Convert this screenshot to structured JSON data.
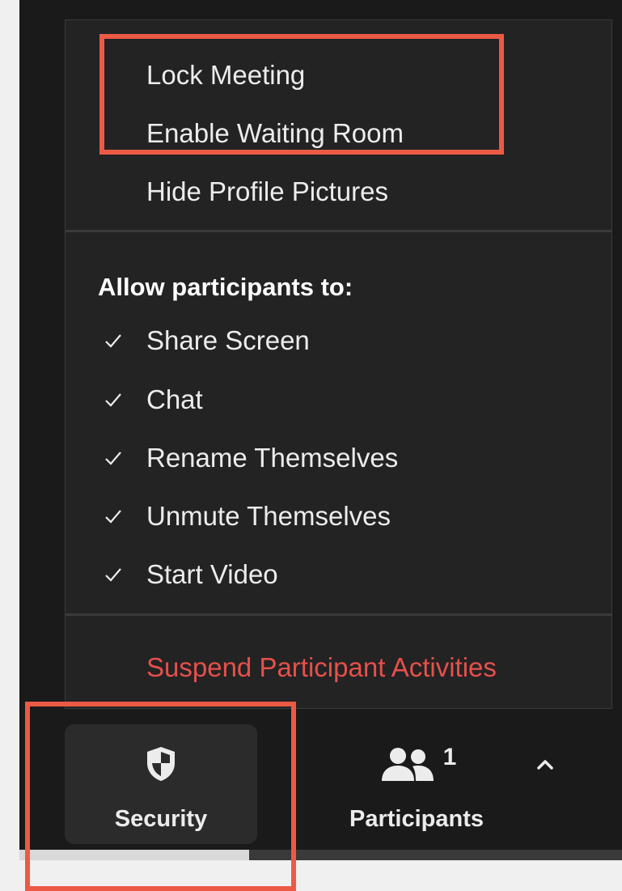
{
  "security_menu": {
    "items": [
      {
        "label": "Lock Meeting"
      },
      {
        "label": "Enable Waiting Room"
      },
      {
        "label": "Hide Profile Pictures"
      }
    ],
    "allow_heading": "Allow participants to:",
    "permissions": [
      {
        "label": "Share Screen",
        "checked": true
      },
      {
        "label": "Chat",
        "checked": true
      },
      {
        "label": "Rename Themselves",
        "checked": true
      },
      {
        "label": "Unmute Themselves",
        "checked": true
      },
      {
        "label": "Start Video",
        "checked": true
      }
    ],
    "suspend_label": "Suspend Participant Activities"
  },
  "toolbar": {
    "security_label": "Security",
    "participants_label": "Participants",
    "participant_count": "1"
  },
  "icons": {
    "security": "shield-icon",
    "participants": "people-icon",
    "more": "caret-up-icon",
    "check": "check-icon"
  },
  "colors": {
    "menu_background": "#232323",
    "app_background": "#1a1a1a",
    "danger_text": "#e6504b",
    "annotation": "#ec5a45"
  }
}
